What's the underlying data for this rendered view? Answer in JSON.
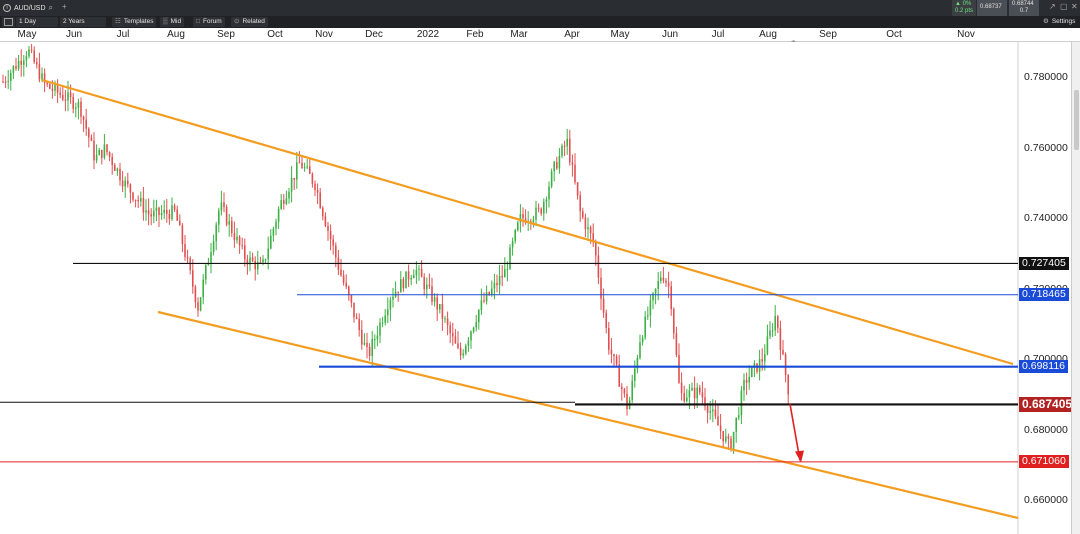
{
  "window": {
    "symbol": "AUD/USD",
    "bid": "0.68737",
    "ask": "0.68744",
    "change_pct": "▲ 0%",
    "change_pts": "0.2 pts",
    "spread": "0.7",
    "settings_label": "Settings"
  },
  "toolbar": {
    "interval": "1 Day",
    "range": "2 Years",
    "templates": "Templates",
    "mid": "Mid",
    "forum": "Forum",
    "related": "Related"
  },
  "chart_data": {
    "type": "candlestick",
    "x_labels": [
      "May",
      "Jun",
      "Jul",
      "Aug",
      "Sep",
      "Oct",
      "Nov",
      "Dec",
      "2022",
      "Feb",
      "Mar",
      "Apr",
      "May",
      "Jun",
      "Jul",
      "Aug",
      "Sep",
      "Oct",
      "Nov"
    ],
    "y_ticks": [
      "0.780000",
      "0.760000",
      "0.740000",
      "0.720000",
      "0.700000",
      "0.680000",
      "0.660000"
    ],
    "ylim": [
      0.652,
      0.792
    ],
    "colors": {
      "up": "#3cb043",
      "down": "#e05050",
      "trend": "#f39c1f",
      "support_blue": "#1a4bd6",
      "resistance_black": "#111111",
      "target_red": "#e02020"
    },
    "horizontal_levels": [
      {
        "label": "0.727405",
        "value": 0.7274,
        "color": "#111111",
        "tag_bg": "#111111",
        "tag_fg": "#ffffff"
      },
      {
        "label": "0.718465",
        "value": 0.7185,
        "color": "#1a4bd6",
        "tag_bg": "#1a4bd6",
        "tag_fg": "#ffffff"
      },
      {
        "label": "0.698116",
        "value": 0.6981,
        "color": "#1a4bd6",
        "tag_bg": "#1a4bd6",
        "tag_fg": "#ffffff"
      },
      {
        "label": "0.687405",
        "value": 0.6874,
        "color": "#111111",
        "tag_bg": "#b22222",
        "tag_fg": "#ffffff"
      },
      {
        "label": "0.671060",
        "value": 0.6711,
        "color": "#e02020",
        "tag_bg": "#e02020",
        "tag_fg": "#ffffff"
      }
    ]
  }
}
